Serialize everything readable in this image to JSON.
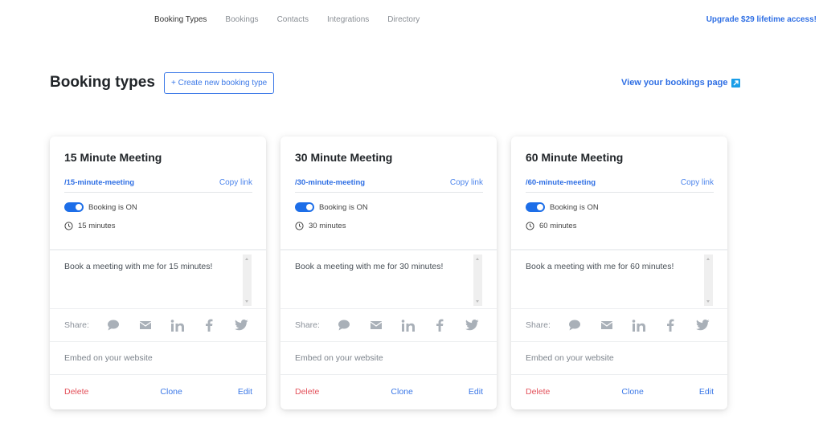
{
  "nav": {
    "tabs": [
      {
        "label": "Booking Types",
        "active": true
      },
      {
        "label": "Bookings",
        "active": false
      },
      {
        "label": "Contacts",
        "active": false
      },
      {
        "label": "Integrations",
        "active": false
      },
      {
        "label": "Directory",
        "active": false
      }
    ],
    "upgrade_label": "Upgrade $29 lifetime access!"
  },
  "header": {
    "title": "Booking types",
    "create_button_label": "+ Create new booking type",
    "view_link_label": "View your bookings page",
    "view_link_icon": "external-link-icon"
  },
  "colors": {
    "accent": "#2f6fe4",
    "toggle_on": "#1d6ee8",
    "delete": "#e3505a",
    "icon_gray": "#a9b0b8"
  },
  "cards": [
    {
      "title": "15 Minute Meeting",
      "slug": "/15-minute-meeting",
      "copy_label": "Copy link",
      "toggle_label": "Booking is ON",
      "toggle_on": true,
      "duration": "15 minutes",
      "description": "Book a meeting with me for 15 minutes!",
      "share_label": "Share:",
      "share_icons": [
        "chat-icon",
        "email-icon",
        "linkedin-icon",
        "facebook-icon",
        "twitter-icon"
      ],
      "embed_label": "Embed on your website",
      "delete_label": "Delete",
      "clone_label": "Clone",
      "edit_label": "Edit"
    },
    {
      "title": "30 Minute Meeting",
      "slug": "/30-minute-meeting",
      "copy_label": "Copy link",
      "toggle_label": "Booking is ON",
      "toggle_on": true,
      "duration": "30 minutes",
      "description": "Book a meeting with me for 30 minutes!",
      "share_label": "Share:",
      "share_icons": [
        "chat-icon",
        "email-icon",
        "linkedin-icon",
        "facebook-icon",
        "twitter-icon"
      ],
      "embed_label": "Embed on your website",
      "delete_label": "Delete",
      "clone_label": "Clone",
      "edit_label": "Edit"
    },
    {
      "title": "60 Minute Meeting",
      "slug": "/60-minute-meeting",
      "copy_label": "Copy link",
      "toggle_label": "Booking is ON",
      "toggle_on": true,
      "duration": "60 minutes",
      "description": "Book a meeting with me for 60 minutes!",
      "share_label": "Share:",
      "share_icons": [
        "chat-icon",
        "email-icon",
        "linkedin-icon",
        "facebook-icon",
        "twitter-icon"
      ],
      "embed_label": "Embed on your website",
      "delete_label": "Delete",
      "clone_label": "Clone",
      "edit_label": "Edit"
    }
  ]
}
